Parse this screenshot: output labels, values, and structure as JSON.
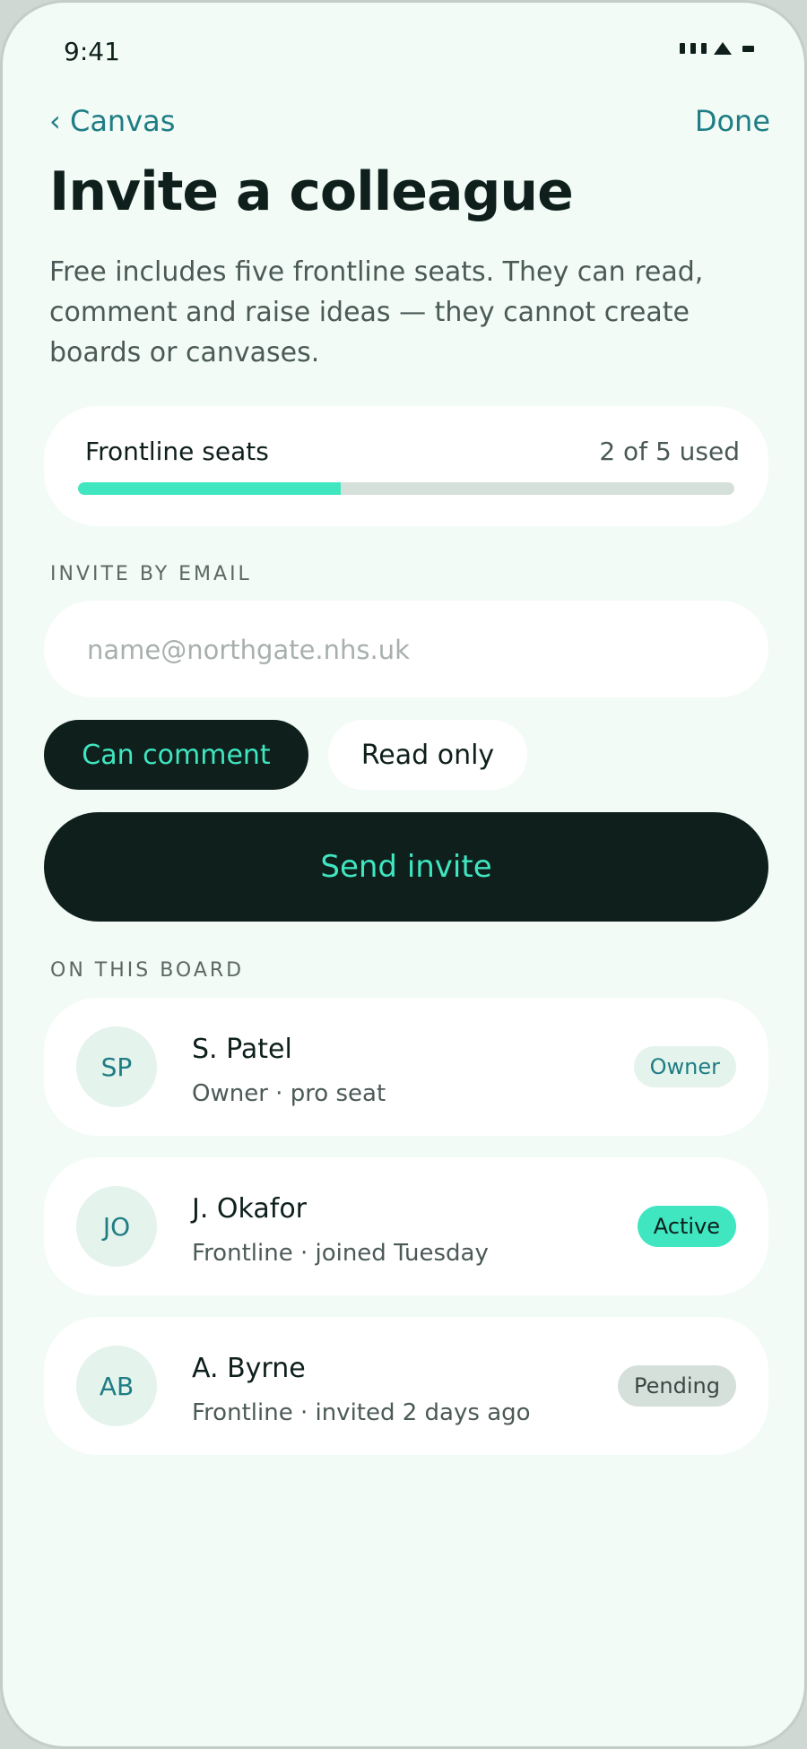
{
  "status_bar": {
    "time": "9:41"
  },
  "nav": {
    "back_chevron": "‹",
    "back_label": "Canvas",
    "done_label": "Done"
  },
  "header": {
    "title": "Invite a colleague",
    "description": "Free includes five frontline seats. They can read, comment and raise ideas — they cannot create boards or canvases."
  },
  "seats": {
    "label": "Frontline seats",
    "count_text": "2 of 5 used",
    "used": 2,
    "total": 5,
    "fill_color": "#3fe6c0"
  },
  "invite": {
    "section_label": "INVITE BY EMAIL",
    "email_placeholder": "name@northgate.nhs.uk",
    "email_value": "",
    "permission_options": [
      "Can comment",
      "Read only"
    ],
    "selected_permission": "Can comment",
    "send_label": "Send invite"
  },
  "board": {
    "section_label": "ON THIS BOARD",
    "members": [
      {
        "initials": "SP",
        "name": "S. Patel",
        "detail": "Owner · pro seat",
        "badge": "Owner",
        "badge_bg": "#e4f3ec",
        "badge_fg": "#1f7d84"
      },
      {
        "initials": "JO",
        "name": "J. Okafor",
        "detail": "Frontline · joined Tuesday",
        "badge": "Active",
        "badge_bg": "#3fe6c0",
        "badge_fg": "#0e1f1c"
      },
      {
        "initials": "AB",
        "name": "A. Byrne",
        "detail": "Frontline · invited 2 days ago",
        "badge": "Pending",
        "badge_bg": "#d6e0db",
        "badge_fg": "#3b4845"
      }
    ]
  },
  "colors": {
    "accent": "#3fe6c0",
    "ink": "#0e1f1c",
    "link": "#1f7d84",
    "background": "#f2fbf6"
  }
}
